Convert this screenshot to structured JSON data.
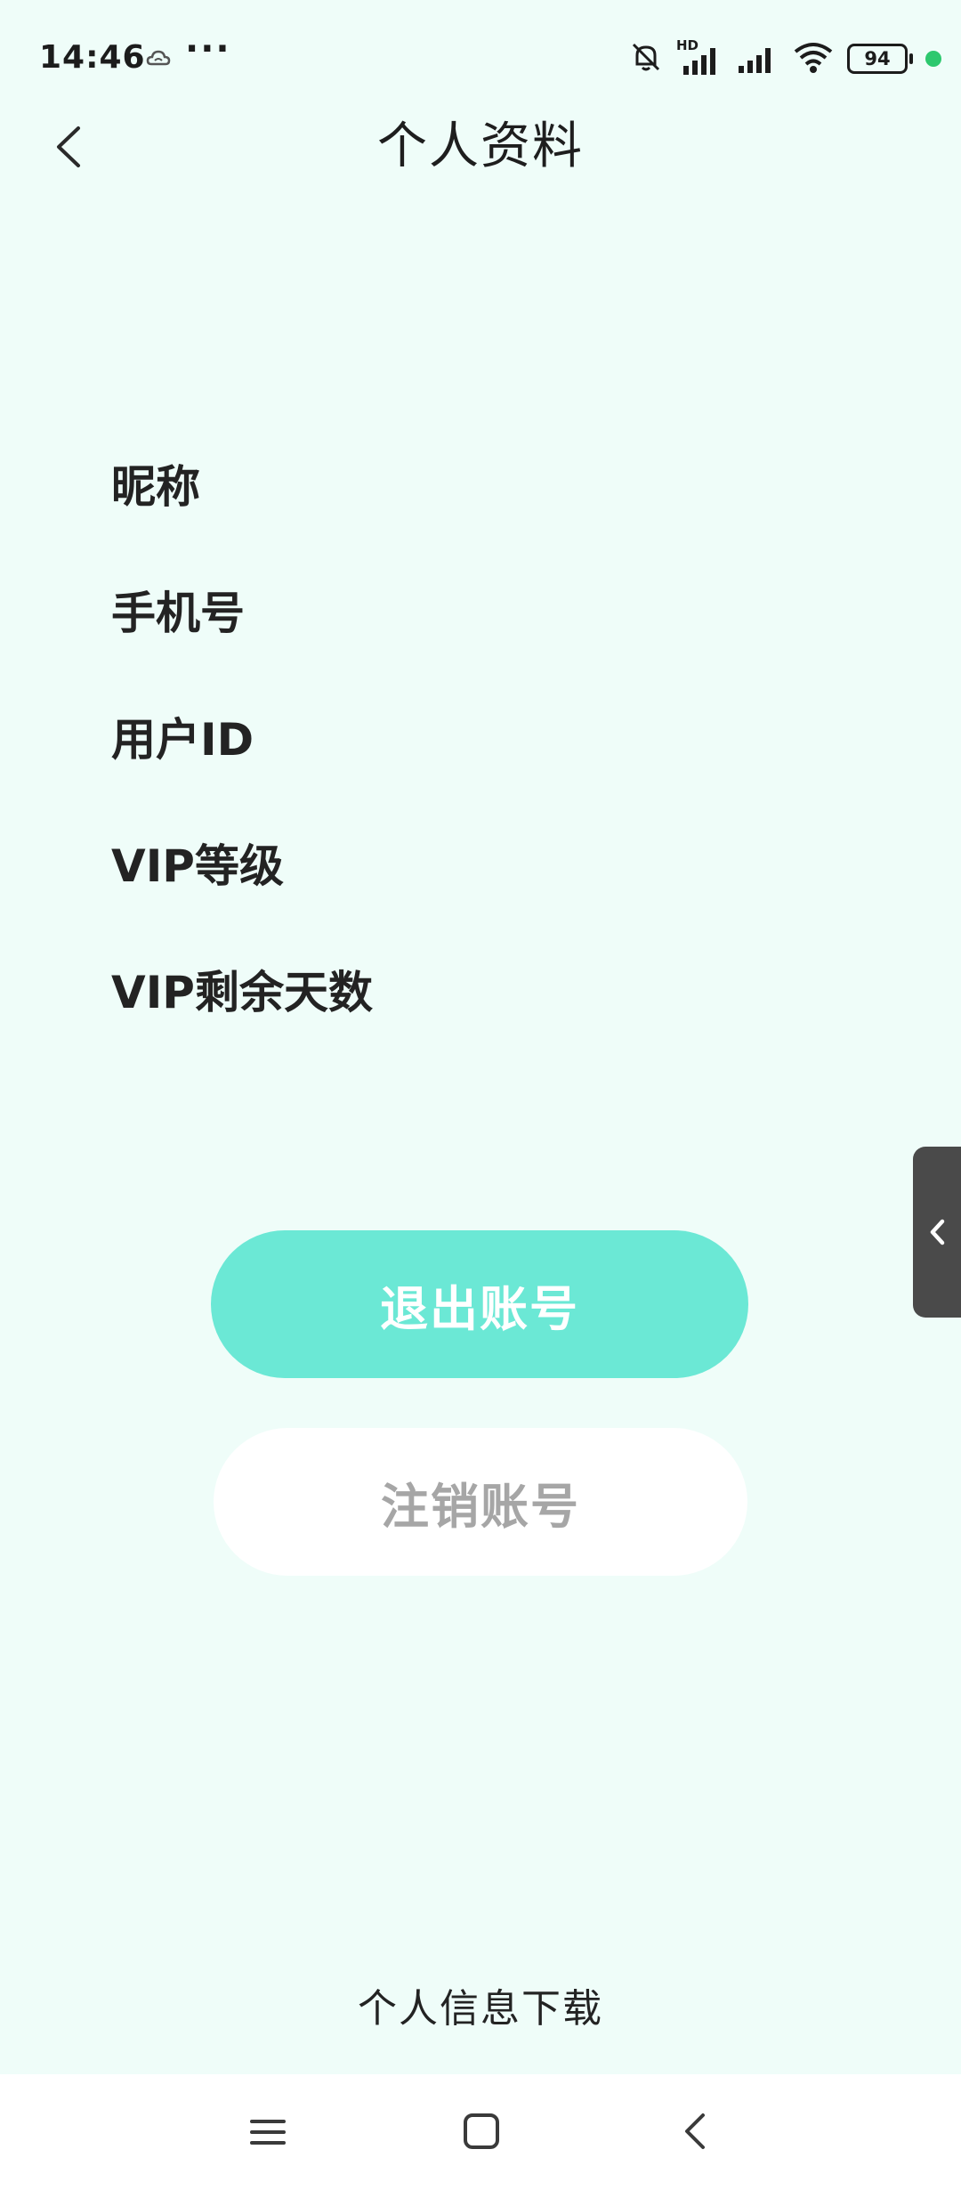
{
  "status_bar": {
    "time": "14:46",
    "more": "···",
    "network_label": "HD",
    "battery_level": "94",
    "dot_color": "#2dc86e"
  },
  "header": {
    "title": "个人资料"
  },
  "fields": [
    {
      "label": "昵称"
    },
    {
      "label": "手机号"
    },
    {
      "label": "用户ID"
    },
    {
      "label": "VIP等级"
    },
    {
      "label": "VIP剩余天数"
    }
  ],
  "actions": {
    "logout_label": "退出账号",
    "cancel_account_label": "注销账号",
    "download_label": "个人信息下载"
  },
  "colors": {
    "background": "#effdf9",
    "primary": "#6be8d5",
    "secondary_text": "#a6a6a6"
  },
  "icons": {
    "back": "chevron-left-icon",
    "side_handle": "chevron-left-icon",
    "nav_menu": "menu-icon",
    "nav_home": "square-icon",
    "nav_back": "chevron-left-icon"
  }
}
